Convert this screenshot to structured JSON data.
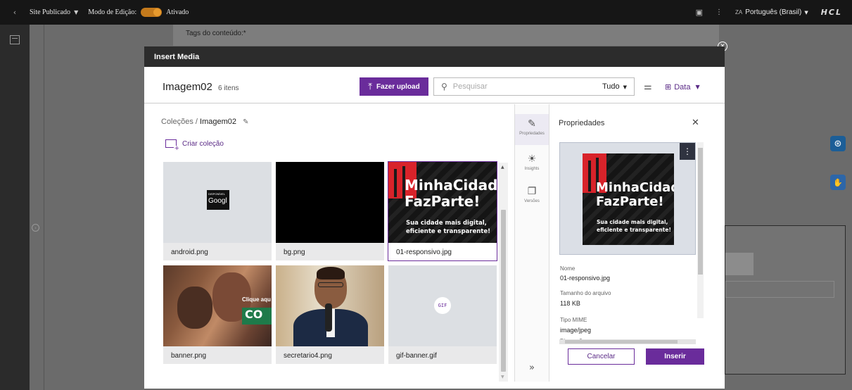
{
  "topbar": {
    "back_icon": "‹",
    "site_label": "Site Publicado",
    "edit_mode_label": "Modo de Edição:",
    "edit_mode_state": "Ativado",
    "language": "Português (Brasil)",
    "logo": "HCL",
    "language_icon": "ZA"
  },
  "background": {
    "content_tags_label": "Tags do conteúdo:*"
  },
  "modal": {
    "title": "Insert Media",
    "collection_title": "Imagem02",
    "item_count": "6 itens",
    "upload_label": "Fazer upload",
    "search_placeholder": "Pesquisar",
    "filter_value": "Tudo",
    "sort_label": "Data",
    "breadcrumb_root": "Coleções",
    "breadcrumb_sep": "/",
    "breadcrumb_current": "Imagem02",
    "new_collection_label": "Criar coleção",
    "items": [
      {
        "name": "android.png",
        "thumb_text_1": "DISPONÍVEL",
        "thumb_text_2": "Googl"
      },
      {
        "name": "bg.png"
      },
      {
        "name": "01-responsivo.jpg",
        "poster_title_1": "MinhaCidad",
        "poster_title_2": "FazParte!",
        "poster_sub_1": "Sua cidade mais digital,",
        "poster_sub_2": "eficiente e transparente!"
      },
      {
        "name": "banner.png",
        "thumb_text_1": "Clique aqu",
        "thumb_text_2": "CO"
      },
      {
        "name": "secretario4.png"
      },
      {
        "name": "gif-banner.gif",
        "badge": "GIF"
      }
    ],
    "siderail": {
      "properties": "Propriedades",
      "insights": "Insights",
      "versions": "Versões"
    },
    "properties": {
      "title": "Propriedades",
      "name_label": "Nome",
      "name_value": "01-responsivo.jpg",
      "size_label": "Tamanho do arquivo",
      "size_value": "118 KB",
      "mime_label": "Tipo MIME",
      "mime_value": "image/jpeg",
      "dimensions_label": "Dimensões"
    },
    "cancel_label": "Cancelar",
    "insert_label": "Inserir"
  },
  "colors": {
    "accent": "#6a2c9b",
    "header": "#2c2c2c",
    "poster_red": "#d8232a"
  }
}
